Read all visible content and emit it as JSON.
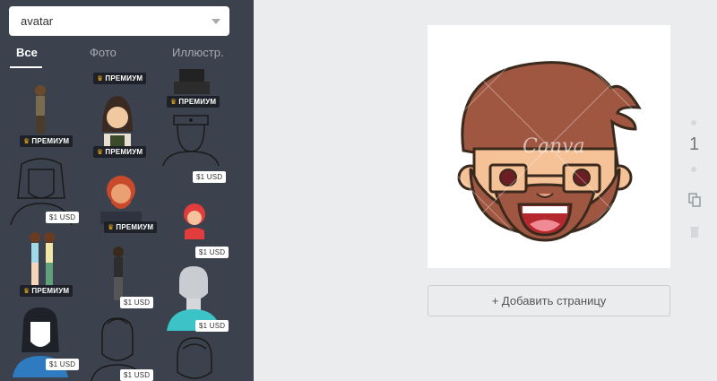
{
  "search": {
    "value": "avatar"
  },
  "tabs": [
    {
      "label": "Все"
    },
    {
      "label": "Фото"
    },
    {
      "label": "Иллюстр."
    }
  ],
  "badges": {
    "premium": "ПРЕМИУМ",
    "usd": "$1 USD"
  },
  "canvas": {
    "watermark": "Canva"
  },
  "add_page_label": "+ Добавить страницу",
  "page_number": "1",
  "icons": {
    "duplicate": "copy-icon",
    "delete": "trash-icon",
    "crown": "crown-icon"
  },
  "colors": {
    "sidebar": "#3b424d",
    "workspace": "#ebecee",
    "premium_crown": "#f5b21b"
  }
}
